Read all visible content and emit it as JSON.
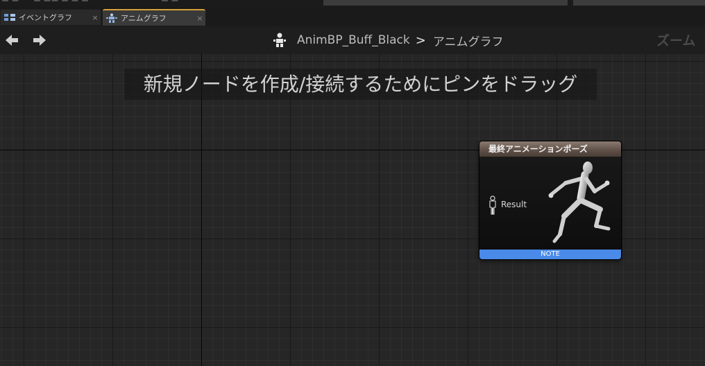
{
  "top_menu": {
    "fragment_1": "ー ー",
    "fragment_2": "ー ーー ー ー ー",
    "fragment_3": "ー ー"
  },
  "tabs": [
    {
      "label": "イベントグラフ",
      "close": "×",
      "active": false
    },
    {
      "label": "アニムグラフ",
      "close": "×",
      "active": true
    }
  ],
  "header": {
    "blueprint_name": "AnimBP_Buff_Black",
    "separator": ">",
    "graph_name": "アニムグラフ",
    "zoom_label": "ズーム"
  },
  "canvas": {
    "hint": "新規ノードを作成/接続するためにピンをドラッグ"
  },
  "node": {
    "title": "最終アニメーションポーズ",
    "pin_label": "Result",
    "footer": "NOTE"
  },
  "colors": {
    "active_tab_accent": "#d9a13a",
    "node_footer": "#4a8ae8",
    "node_header": "#6e5e55"
  }
}
